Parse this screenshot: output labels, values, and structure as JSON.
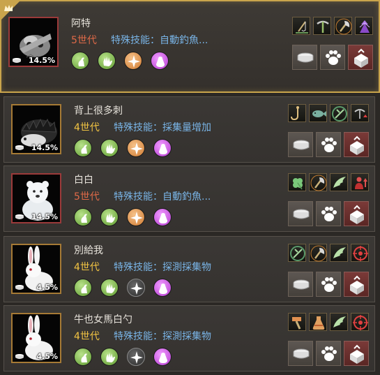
{
  "pets": [
    {
      "name": "阿特",
      "generation": "5世代",
      "skill": "特殊技能：自動釣魚...",
      "percent": "14.5%",
      "selected": true,
      "portrait": "owl-icon",
      "traits": [
        "green",
        "green",
        "orange",
        "purple"
      ],
      "skill_icons": [
        "fishing-icon",
        "pickaxe-icon",
        "axe-icon",
        "upgrade-icon"
      ]
    },
    {
      "name": "背上很多刺",
      "generation": "4世代",
      "skill": "特殊技能：採集量增加",
      "percent": "14.5%",
      "selected": false,
      "portrait": "hedgehog-icon",
      "traits": [
        "green",
        "green",
        "orange",
        "purple"
      ],
      "skill_icons": [
        "hook-icon",
        "fish-icon",
        "gather-icon",
        "pickaxe-up-icon"
      ]
    },
    {
      "name": "白白",
      "generation": "5世代",
      "skill": "特殊技能：自動釣魚...",
      "percent": "14.5%",
      "selected": false,
      "portrait": "polar-bear-icon",
      "traits": [
        "green",
        "green",
        "orange",
        "purple"
      ],
      "skill_icons": [
        "clover-icon",
        "axe-icon",
        "wing-icon",
        "person-up-icon"
      ]
    },
    {
      "name": "別給我",
      "generation": "4世代",
      "skill": "特殊技能：探測採集物",
      "percent": "4.5%",
      "selected": false,
      "portrait": "rabbit-icon",
      "traits": [
        "green",
        "green",
        "grey",
        "purple"
      ],
      "skill_icons": [
        "gather-icon",
        "axe-icon",
        "wing-icon",
        "target-icon"
      ]
    },
    {
      "name": "牛也女馬白勺",
      "generation": "4世代",
      "skill": "特殊技能：探測採集物",
      "percent": "4.5%",
      "selected": false,
      "portrait": "rabbit-icon",
      "traits": [
        "green",
        "green",
        "grey",
        "purple"
      ],
      "skill_icons": [
        "hammer-icon",
        "potion-icon",
        "wing-icon",
        "target-icon"
      ]
    }
  ],
  "actions": [
    "feed-icon",
    "paw-icon",
    "release-icon"
  ],
  "colors": {
    "gen5": "#e06a48",
    "gen4": "#f2c443",
    "skill_text": "#79b4e6",
    "selected_border": "#c9a44c"
  }
}
